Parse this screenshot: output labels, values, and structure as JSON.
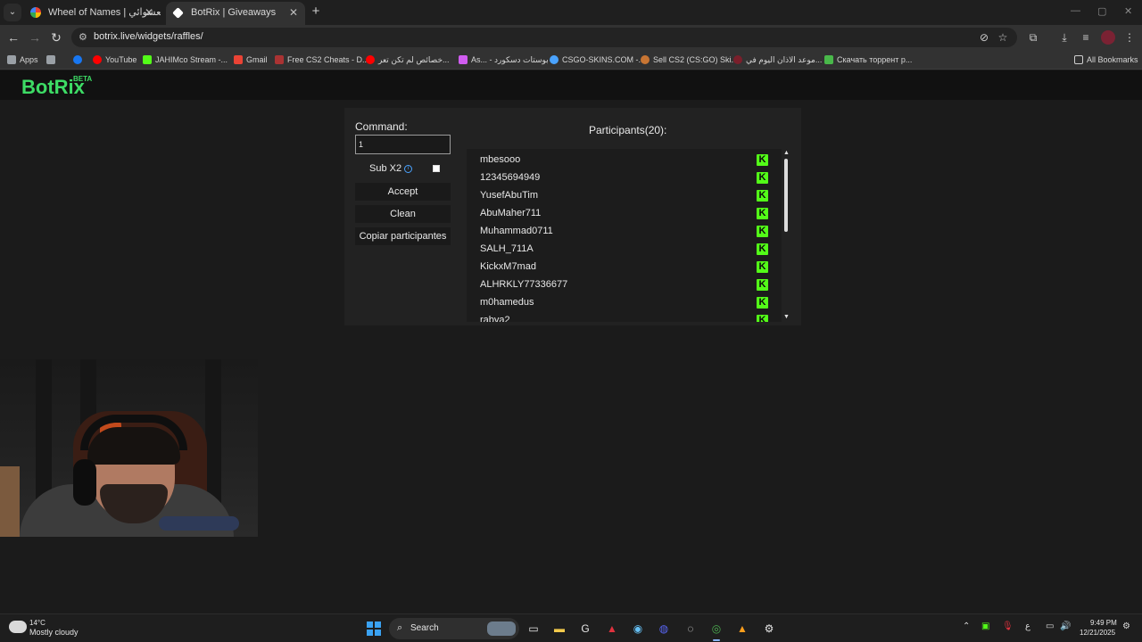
{
  "browser": {
    "tabs": [
      {
        "title": "Wheel of Names | اسم العشوائي",
        "active": false
      },
      {
        "title": "BotRix | Giveaways",
        "active": true
      }
    ],
    "url": "botrix.live/widgets/raffles/",
    "bookmarks": [
      {
        "label": "Apps",
        "color": "#9aa0a6"
      },
      {
        "label": "",
        "color": "#1877f2"
      },
      {
        "label": "YouTube",
        "color": "#ff0000"
      },
      {
        "label": "JAHIMco Stream -...",
        "color": "#53fc18"
      },
      {
        "label": "Gmail",
        "color": "#ea4335"
      },
      {
        "label": "Free CS2 Cheats - D...",
        "color": "#a33"
      },
      {
        "label": "خصائص لم تكن تعر...",
        "color": "#ff0000"
      },
      {
        "label": "As... - بوستات دسكورد",
        "color": "#d05cf0"
      },
      {
        "label": "CSGO-SKINS.COM -...",
        "color": "#4aa3ff"
      },
      {
        "label": "Sell CS2 (CS:GO) Ski...",
        "color": "#c87533"
      },
      {
        "label": "موعد الاذان اليوم في...",
        "color": "#7a1f2b"
      },
      {
        "label": "Скачать торрент р...",
        "color": "#49b84a"
      },
      {
        "label": "All Bookmarks",
        "color": "#9aa0a6"
      }
    ]
  },
  "botrix": {
    "logo": "BotRix",
    "logo_badge": "BETA",
    "command_label": "Command:",
    "command_value": "1",
    "sub_label": "Sub X2",
    "sub_checked": false,
    "buttons": [
      "Accept",
      "Clean",
      "Copiar participantes"
    ],
    "participants_title": "Participants(20):",
    "participants": [
      "mbesooo",
      "12345694949",
      "YusefAbuTim",
      "AbuMaher711",
      "Muhammad0711",
      "SALH_711A",
      "KickxM7mad",
      "ALHRKLY77336677",
      "m0hamedus",
      "rabya2"
    ],
    "platform_badge": "K",
    "accent": "#3ddc65",
    "kick_green": "#53fc18"
  },
  "taskbar": {
    "temp": "14°C",
    "weather": "Mostly cloudy",
    "search": "Search",
    "time": "9:49 PM",
    "date": "12/21/2025",
    "lang": "ع"
  }
}
